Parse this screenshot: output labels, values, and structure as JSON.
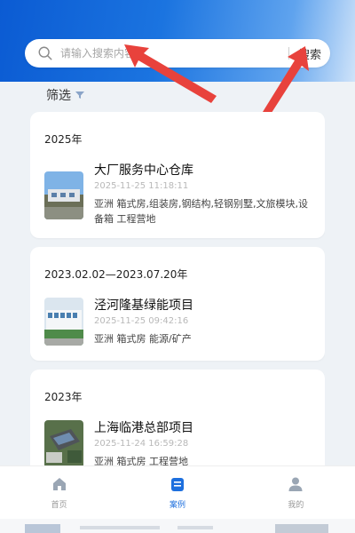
{
  "search": {
    "placeholder": "请输入搜索内容",
    "button_label": "搜索"
  },
  "filter": {
    "label": "筛选"
  },
  "cases": [
    {
      "period": "2025年",
      "title": "大厂服务中心仓库",
      "date": "2025-11-25 11:18:11",
      "tags": "亚洲 箱式房,组装房,钢结构,轻钢别墅,文旅模块,设备箱 工程营地"
    },
    {
      "period": "2023.02.02—2023.07.20年",
      "title": "泾河隆基绿能项目",
      "date": "2025-11-25 09:42:16",
      "tags": "亚洲 箱式房 能源/矿产"
    },
    {
      "period": "2023年",
      "title": "上海临港总部项目",
      "date": "2025-11-24 16:59:28",
      "tags": "亚洲 箱式房 工程营地"
    }
  ],
  "nav": {
    "items": [
      {
        "label": "首页",
        "icon": "home-icon",
        "active": false
      },
      {
        "label": "案例",
        "icon": "case-icon",
        "active": true
      },
      {
        "label": "我的",
        "icon": "user-icon",
        "active": false
      }
    ]
  },
  "colors": {
    "accent": "#1d6fde",
    "arrow": "#e8423c"
  }
}
